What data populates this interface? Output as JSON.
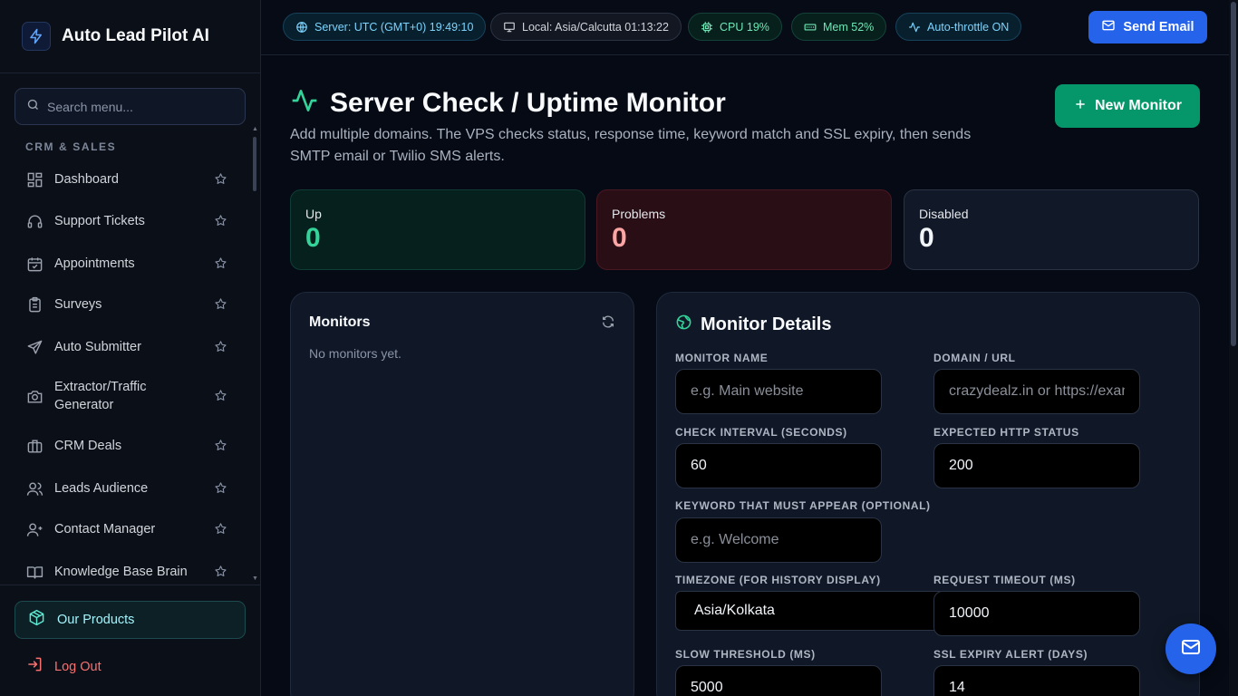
{
  "brand": {
    "name": "Auto Lead Pilot AI"
  },
  "sidebar": {
    "search_placeholder": "Search menu...",
    "section_label": "CRM & SALES",
    "items": [
      {
        "label": "Dashboard",
        "icon": "dashboard-icon"
      },
      {
        "label": "Support Tickets",
        "icon": "headset-icon"
      },
      {
        "label": "Appointments",
        "icon": "calendar-icon"
      },
      {
        "label": "Surveys",
        "icon": "clipboard-icon"
      },
      {
        "label": "Auto Submitter",
        "icon": "send-icon"
      },
      {
        "label": "Extractor/Traffic Generator",
        "icon": "camera-icon"
      },
      {
        "label": "CRM Deals",
        "icon": "briefcase-icon"
      },
      {
        "label": "Leads Audience",
        "icon": "users-icon"
      },
      {
        "label": "Contact Manager",
        "icon": "contacts-icon"
      },
      {
        "label": "Knowledge Base Brain",
        "icon": "book-icon"
      }
    ],
    "products_label": "Our Products",
    "logout_label": "Log Out"
  },
  "topbar": {
    "server_time": "Server: UTC (GMT+0) 19:49:10",
    "local_time": "Local: Asia/Calcutta 01:13:22",
    "cpu": "CPU 19%",
    "mem": "Mem 52%",
    "auto_throttle": "Auto-throttle ON",
    "send_email_label": "Send Email"
  },
  "page": {
    "title": "Server Check / Uptime Monitor",
    "description": "Add multiple domains. The VPS checks status, response time, keyword match and SSL expiry, then sends SMTP email or Twilio SMS alerts.",
    "new_monitor_label": "New Monitor"
  },
  "stats": {
    "up": {
      "label": "Up",
      "value": "0"
    },
    "problems": {
      "label": "Problems",
      "value": "0"
    },
    "disabled": {
      "label": "Disabled",
      "value": "0"
    }
  },
  "monitors": {
    "title": "Monitors",
    "empty_text": "No monitors yet."
  },
  "details": {
    "title": "Monitor Details",
    "monitor_name": {
      "label": "MONITOR NAME",
      "value": "",
      "placeholder": "e.g. Main website"
    },
    "domain_url": {
      "label": "DOMAIN / URL",
      "value": "",
      "placeholder": "crazydealz.in or https://example.com"
    },
    "check_interval": {
      "label": "CHECK INTERVAL (SECONDS)",
      "value": "60"
    },
    "expected_status": {
      "label": "EXPECTED HTTP STATUS",
      "value": "200"
    },
    "keyword": {
      "label": "KEYWORD THAT MUST APPEAR (OPTIONAL)",
      "value": "",
      "placeholder": "e.g. Welcome"
    },
    "timezone": {
      "label": "TIMEZONE (FOR HISTORY DISPLAY)",
      "value": "Asia/Kolkata"
    },
    "request_timeout": {
      "label": "REQUEST TIMEOUT (MS)",
      "value": "10000"
    },
    "slow_threshold": {
      "label": "SLOW THRESHOLD (MS)",
      "value": "5000"
    },
    "ssl_alert": {
      "label": "SSL EXPIRY ALERT (DAYS)",
      "value": "14"
    }
  },
  "colors": {
    "accent_blue": "#2563eb",
    "accent_green": "#059669",
    "up_green": "#34d399",
    "problem_red": "#fca5a5"
  }
}
